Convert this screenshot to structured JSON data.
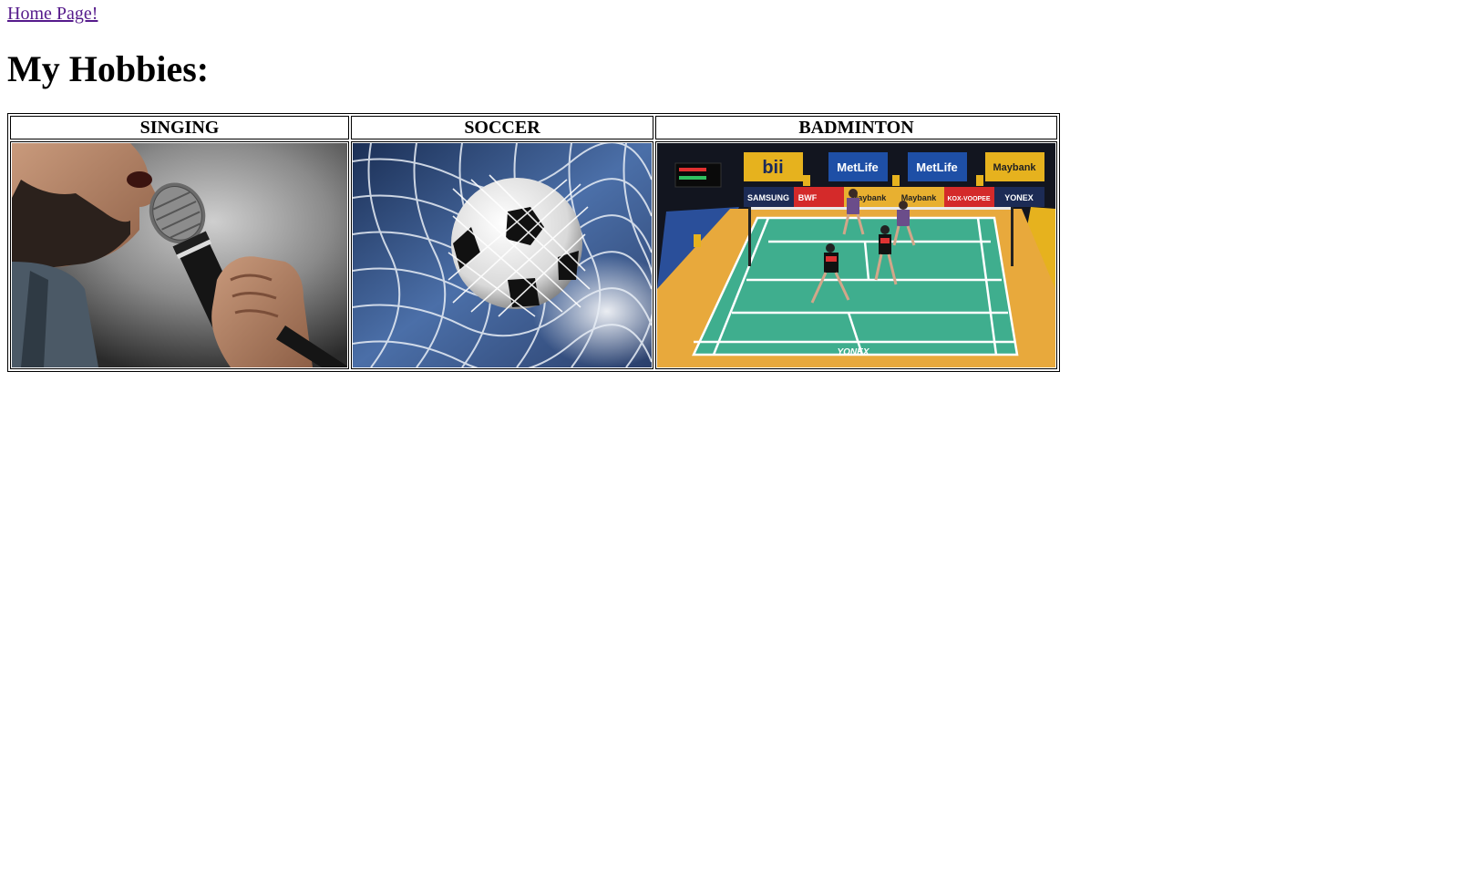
{
  "nav": {
    "home_link": "Home Page!"
  },
  "page": {
    "title": "My Hobbies:"
  },
  "hobbies": [
    {
      "label": "SINGING"
    },
    {
      "label": "SOCCER"
    },
    {
      "label": "BADMINTON"
    }
  ],
  "badminton_photo": {
    "banners": [
      "bii",
      "MetLife",
      "MetLife",
      "Maybank",
      "SAMSUNG",
      "BWF",
      "Maybank",
      "Maybank",
      "KOX-VOOPEE",
      "YONEX"
    ],
    "court_logo": "YONEX"
  },
  "colors": {
    "link_visited": "#551a8b",
    "court": "#3fae8e",
    "court_surround": "#e8a93c"
  }
}
